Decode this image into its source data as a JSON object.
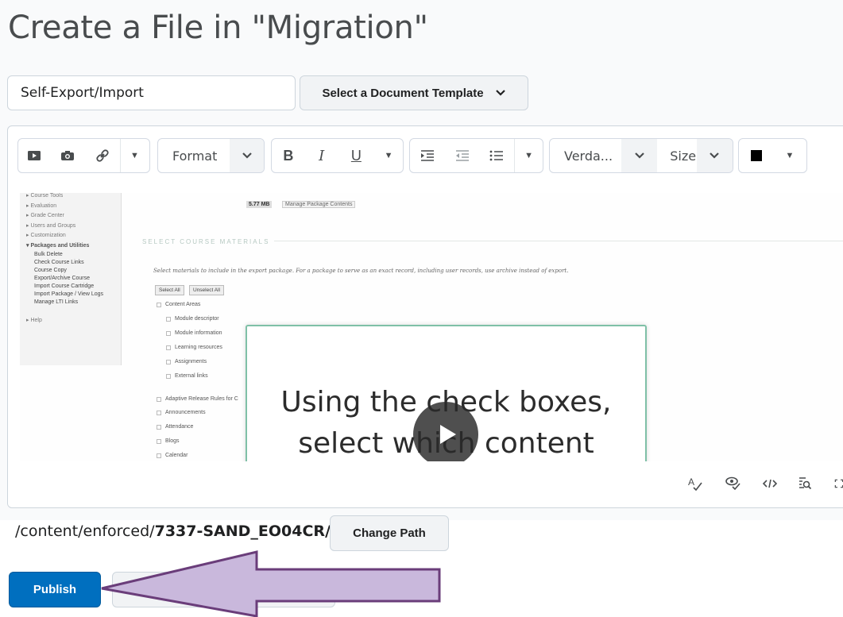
{
  "header": {
    "title": "Create a File in \"Migration\""
  },
  "form": {
    "title_value": "Self-Export/Import",
    "template_button": "Select a Document Template"
  },
  "toolbar": {
    "format_label": "Format",
    "font_label": "Verda...",
    "size_label": "Size",
    "bold": "B",
    "italic": "I",
    "underline": "U"
  },
  "video": {
    "package_size": "5.77 MB",
    "manage_button": "Manage Package Contents",
    "section_title": "SELECT COURSE MATERIALS",
    "instruction": "Select materials to include in the export package. For a package to serve as an exact record, including user records, use archive instead of export.",
    "select_all": "Select All",
    "unselect_all": "Unselect All",
    "sidebar": [
      "Course Tools",
      "Evaluation",
      "Grade Center",
      "Users and Groups",
      "Customization",
      "Packages and Utilities"
    ],
    "sidebar_sub": [
      "Bulk Delete",
      "Check Course Links",
      "Course Copy",
      "Export/Archive Course",
      "Import Course Cartridge",
      "Import Package / View Logs",
      "Manage LTI Links"
    ],
    "sidebar_help": "Help",
    "checkbox_group": "Content Areas",
    "checkbox_items": [
      "Module descriptor",
      "Module information",
      "Learning resources",
      "Assignments",
      "External links"
    ],
    "other_items": [
      "Adaptive Release Rules for C",
      "Announcements",
      "Attendance",
      "Blogs",
      "Calendar"
    ],
    "overlay_line1": "Using the check boxes,",
    "overlay_line2": "select which content"
  },
  "path": {
    "prefix": "/content/enforced/",
    "folder": "7337-SAND_EO04CR/"
  },
  "buttons": {
    "change_path": "Change Path",
    "publish": "Publish"
  },
  "colors": {
    "primary": "#006fbf",
    "arrow_fill": "#c9b8dc",
    "arrow_stroke": "#6a3d7a"
  },
  "icons": [
    "insert-video-icon",
    "insert-image-icon",
    "insert-link-icon",
    "indent-icon",
    "outdent-icon",
    "bullet-list-icon",
    "spellcheck-icon",
    "accessibility-icon",
    "source-code-icon",
    "preview-icon",
    "fullscreen-icon"
  ]
}
